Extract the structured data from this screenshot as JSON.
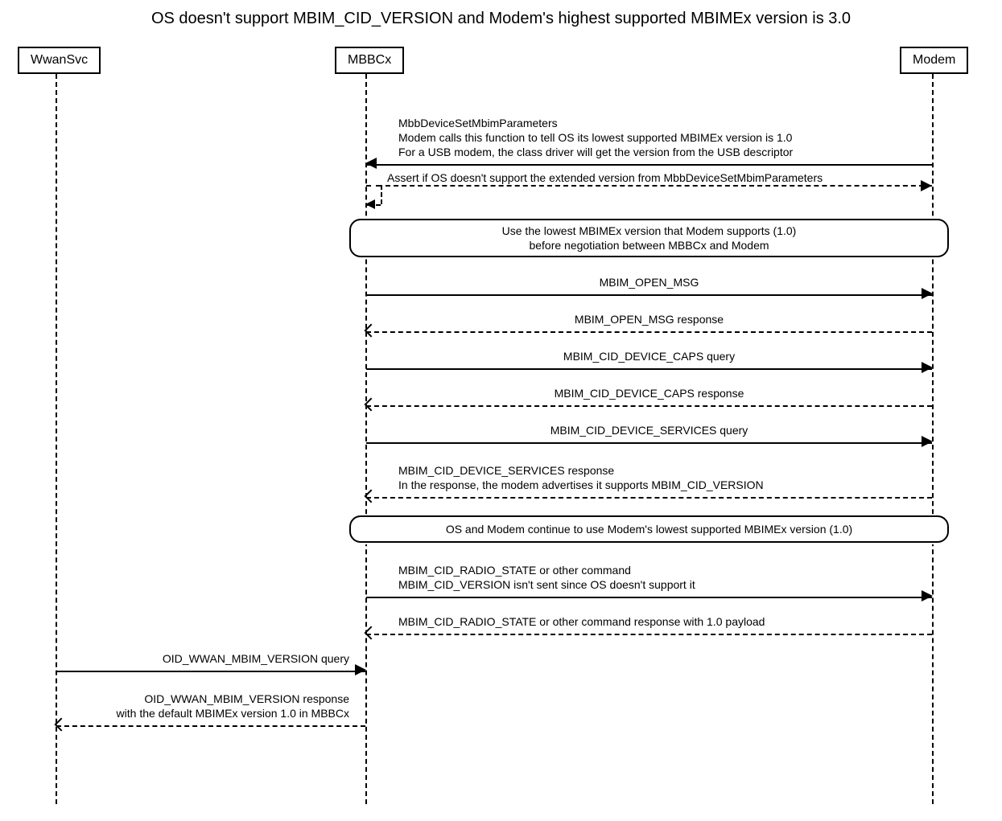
{
  "title": "OS doesn't support MBIM_CID_VERSION and Modem's highest supported MBIMEx version is 3.0",
  "actors": {
    "wwanSvc": "WwanSvc",
    "mbbcx": "MBBCx",
    "modem": "Modem"
  },
  "steps": {
    "s1": {
      "l1": "MbbDeviceSetMbimParameters",
      "l2": "Modem calls this function to tell OS its lowest supported MBIMEx version is 1.0",
      "l3": "For a USB modem, the class driver will get the version from the USB descriptor"
    },
    "s2": "Assert if OS doesn't support the extended version from MbbDeviceSetMbimParameters",
    "note1": {
      "l1": "Use the lowest MBIMEx version that Modem supports (1.0)",
      "l2": "before negotiation between MBBCx and Modem"
    },
    "s3": "MBIM_OPEN_MSG",
    "s4": "MBIM_OPEN_MSG response",
    "s5": "MBIM_CID_DEVICE_CAPS query",
    "s6": "MBIM_CID_DEVICE_CAPS response",
    "s7": "MBIM_CID_DEVICE_SERVICES query",
    "s8": {
      "l1": "MBIM_CID_DEVICE_SERVICES response",
      "l2": "In the response, the modem advertises it supports MBIM_CID_VERSION"
    },
    "note2": "OS and Modem continue to use Modem's lowest supported MBIMEx version (1.0)",
    "s9": {
      "l1": "MBIM_CID_RADIO_STATE or other command",
      "l2": "MBIM_CID_VERSION isn't sent since OS doesn't support it"
    },
    "s10": "MBIM_CID_RADIO_STATE or other command response with 1.0 payload",
    "s11": "OID_WWAN_MBIM_VERSION query",
    "s12": {
      "l1": "OID_WWAN_MBIM_VERSION response",
      "l2": "with the default MBIMEx version 1.0 in MBBCx"
    }
  }
}
